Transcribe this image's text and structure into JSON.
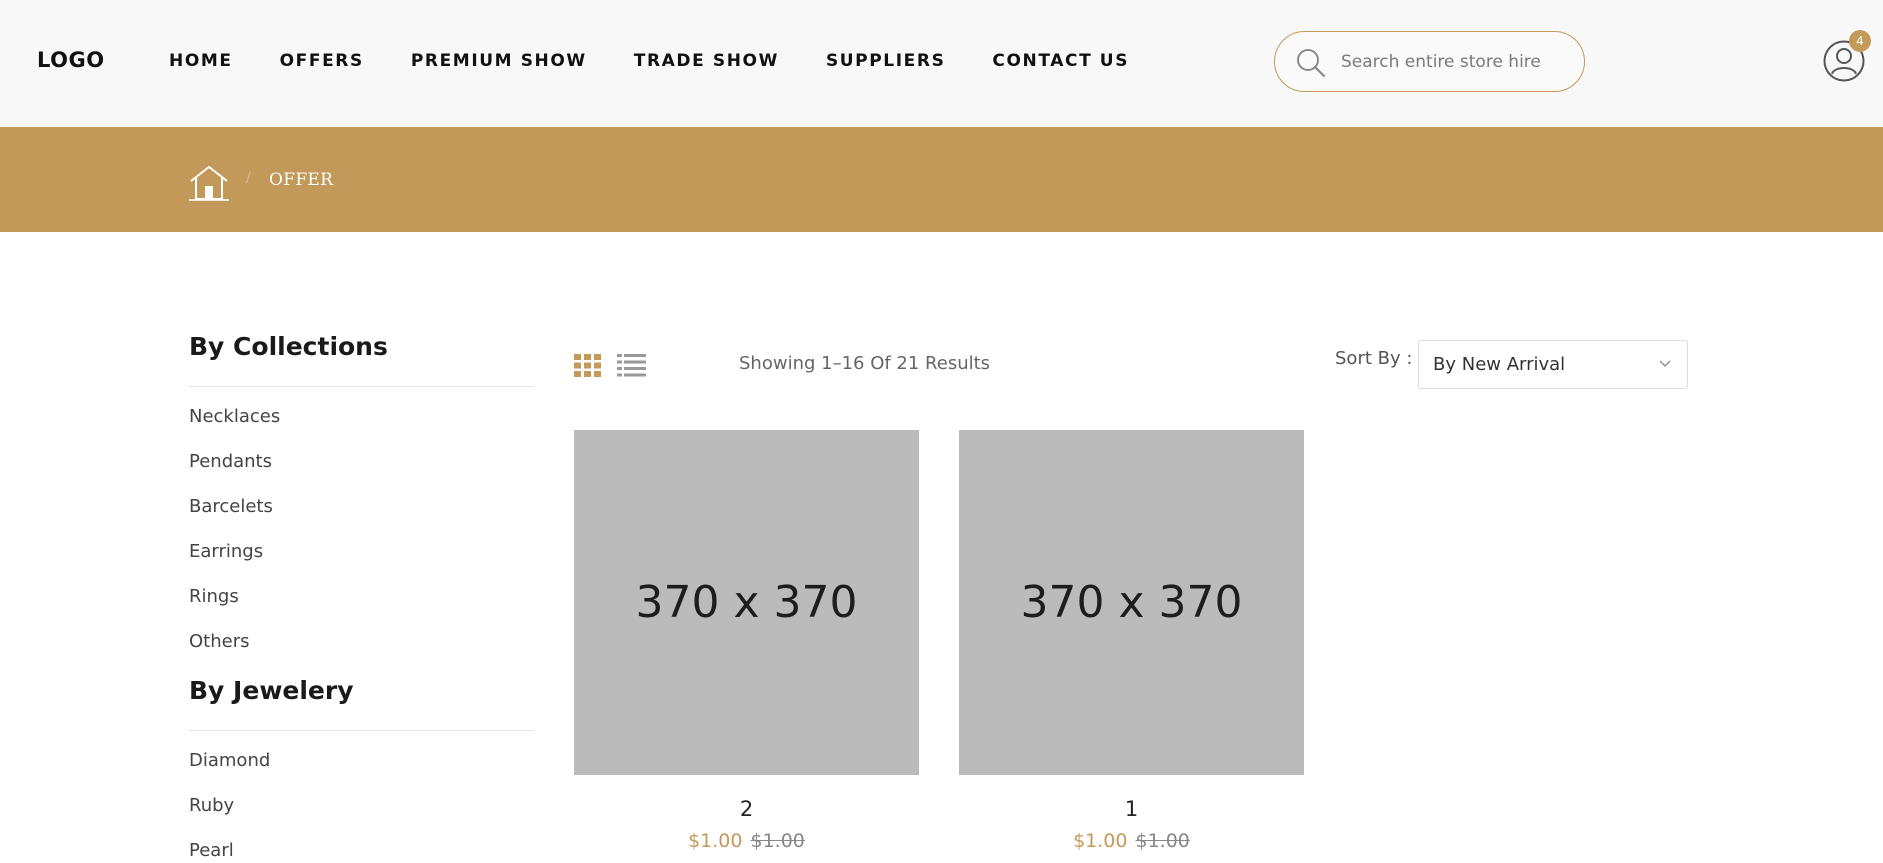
{
  "header": {
    "logo": "LOGO",
    "nav": [
      "HOME",
      "OFFERS",
      "PREMIUM SHOW",
      "TRADE SHOW",
      "SUPPLIERS",
      "CONTACT US"
    ],
    "search_placeholder": "Search entire store hire",
    "cart_count": "4",
    "icons": [
      "search-icon",
      "user-icon"
    ],
    "accent_color": "#c39a58"
  },
  "breadcrumb": {
    "separator": "/",
    "current": "OFFER",
    "bar_color": "#c29958",
    "icons": [
      "home-icon"
    ]
  },
  "sidebar": {
    "collections_title": "By Collections",
    "collections": [
      "Necklaces",
      "Pendants",
      "Barcelets",
      "Earrings",
      "Rings",
      "Others"
    ],
    "jewelery_title": "By Jewelery",
    "jewelery": [
      "Diamond",
      "Ruby",
      "Pearl"
    ]
  },
  "toolbar": {
    "results_text": "Showing 1–16 Of 21 Results",
    "sort_label": "Sort By :",
    "sort_value": "By New Arrival",
    "icons": [
      "grid-view-icon",
      "list-view-icon",
      "chevron-down-icon"
    ]
  },
  "products": [
    {
      "image_text": "370 x 370",
      "name": "2",
      "price": "$1.00",
      "old_price": "$1.00"
    },
    {
      "image_text": "370 x 370",
      "name": "1",
      "price": "$1.00",
      "old_price": "$1.00"
    }
  ]
}
